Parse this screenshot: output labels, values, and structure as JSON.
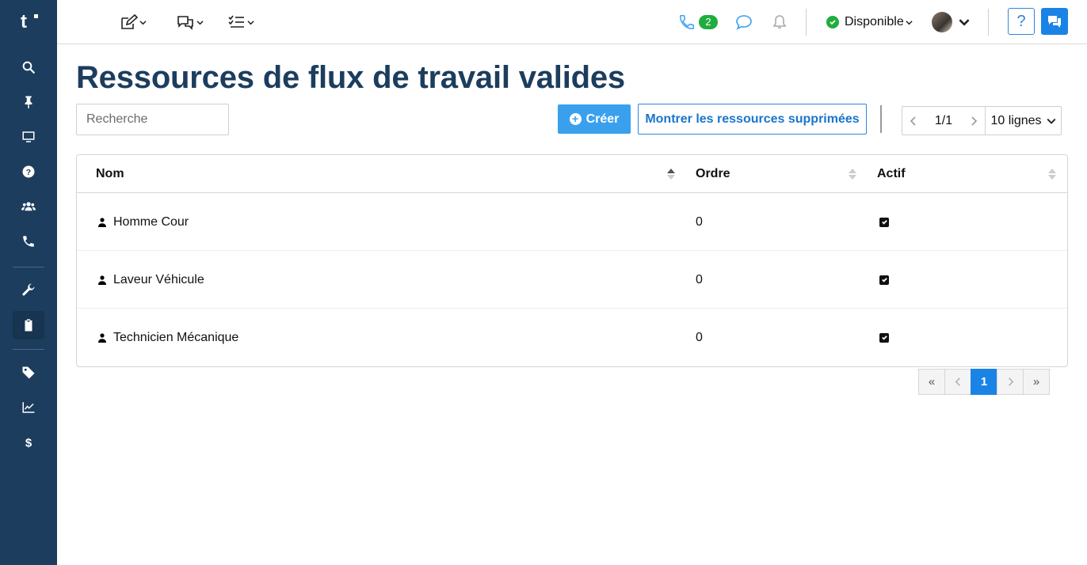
{
  "app": {
    "logo_text": "t"
  },
  "sidebar": {
    "items": [
      {
        "icon": "search-icon"
      },
      {
        "icon": "pin-icon"
      },
      {
        "icon": "monitor-icon"
      },
      {
        "icon": "question-circle-icon"
      },
      {
        "icon": "users-icon"
      },
      {
        "icon": "phone-icon"
      },
      {
        "icon": "wrench-icon"
      },
      {
        "icon": "clipboard-icon",
        "active": true
      },
      {
        "icon": "tag-icon"
      },
      {
        "icon": "chart-line-icon"
      },
      {
        "icon": "dollar-icon"
      }
    ]
  },
  "topbar": {
    "phone_badge": "2",
    "status_label": "Disponible",
    "help_label": "?"
  },
  "page": {
    "title": "Ressources de flux de travail valides",
    "search_placeholder": "Recherche",
    "create_label": "Créer",
    "show_deleted_label": "Montrer les ressources supprimées",
    "page_count": "1/1",
    "rows_label": "10 lignes"
  },
  "table": {
    "columns": [
      "Nom",
      "Ordre",
      "Actif"
    ],
    "rows": [
      {
        "name": "Homme Cour",
        "order": "0",
        "active": true
      },
      {
        "name": "Laveur Véhicule",
        "order": "0",
        "active": true
      },
      {
        "name": "Technicien Mécanique",
        "order": "0",
        "active": true
      }
    ]
  },
  "pagination": {
    "first": "«",
    "last": "»",
    "current": "1"
  },
  "colors": {
    "sidebar": "#1c3d5e",
    "primary": "#1a84e6",
    "create": "#3aa0ee",
    "success": "#1fad3f"
  }
}
